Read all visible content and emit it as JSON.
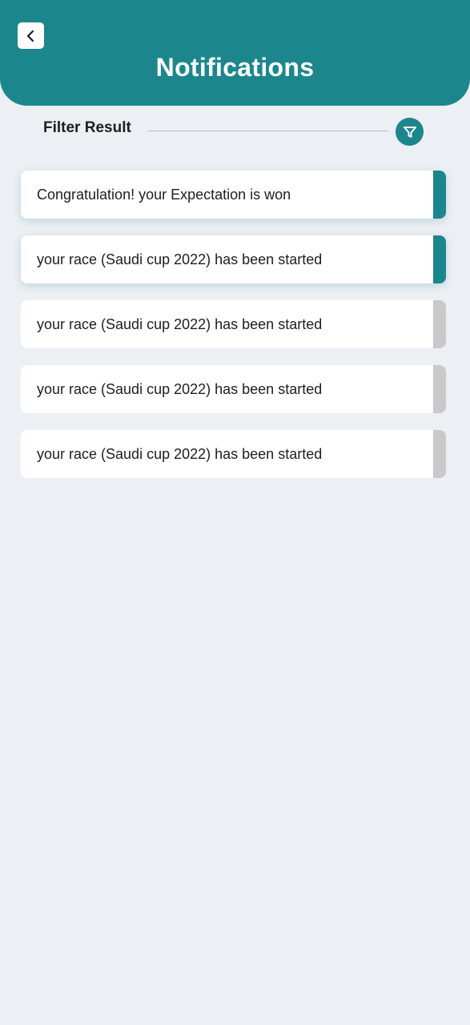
{
  "header": {
    "title": "Notifications",
    "back_icon": "chevron-left-icon"
  },
  "filter": {
    "label": "Filter Result",
    "icon": "filter-icon"
  },
  "colors": {
    "accent": "#1c868d",
    "inactive_indicator": "#c9c9c9",
    "background": "#eceff4"
  },
  "notifications": [
    {
      "text": "Congratulation! your Expectation is won",
      "unread": true
    },
    {
      "text": "your race (Saudi cup 2022) has been started",
      "unread": true
    },
    {
      "text": "your race (Saudi cup 2022) has been started",
      "unread": false
    },
    {
      "text": "your race (Saudi cup 2022) has been started",
      "unread": false
    },
    {
      "text": "your race (Saudi cup 2022) has been started",
      "unread": false
    }
  ]
}
